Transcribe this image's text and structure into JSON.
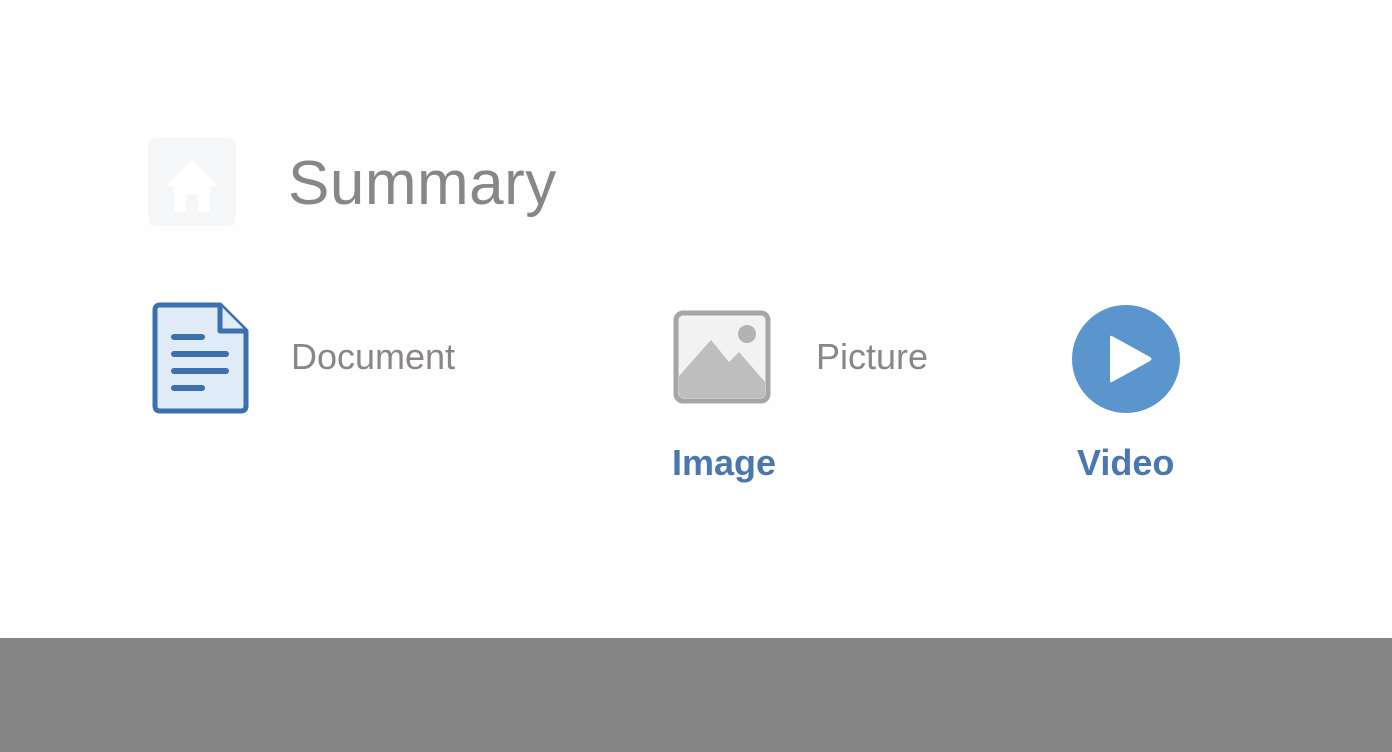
{
  "header": {
    "title": "Summary",
    "icon": "home-icon"
  },
  "items": [
    {
      "label": "Document",
      "icon": "document-icon"
    },
    {
      "label": "Picture",
      "icon": "image-icon",
      "caption": "Image"
    },
    {
      "icon": "play-icon",
      "caption": "Video"
    }
  ],
  "colors": {
    "accent": "#4a78ad",
    "text_muted": "#8a8587",
    "footer": "#858585",
    "play_fill": "#5b95ce"
  }
}
